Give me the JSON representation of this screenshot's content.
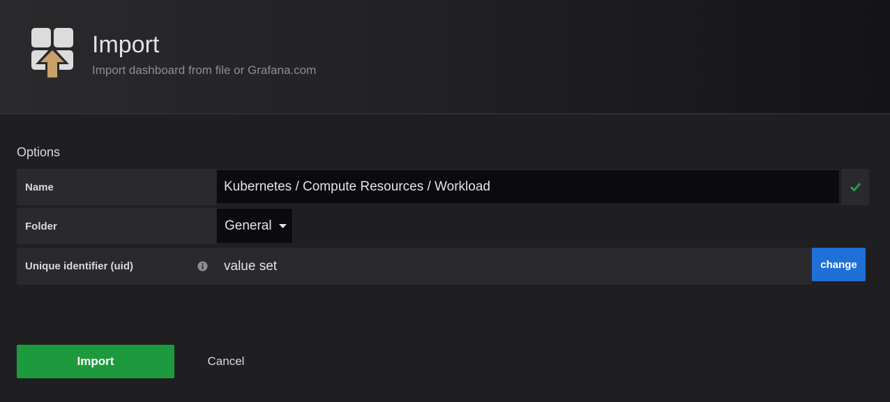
{
  "header": {
    "title": "Import",
    "subtitle": "Import dashboard from file or Grafana.com",
    "icon": "import-dashboard-icon"
  },
  "options": {
    "title": "Options",
    "name": {
      "label": "Name",
      "value": "Kubernetes / Compute Resources / Workload",
      "status_icon": "check-icon"
    },
    "folder": {
      "label": "Folder",
      "value": "General",
      "icon": "caret-down-icon"
    },
    "uid": {
      "label": "Unique identifier (uid)",
      "value": "value set",
      "info_icon": "info-icon",
      "change_label": "change"
    }
  },
  "actions": {
    "import_label": "Import",
    "cancel_label": "Cancel"
  },
  "colors": {
    "background": "#1f1f22",
    "import_button": "#1e9a3e",
    "change_button": "#1f6fd6",
    "check": "#299c46",
    "icon_arrow": "#c9a06a"
  }
}
